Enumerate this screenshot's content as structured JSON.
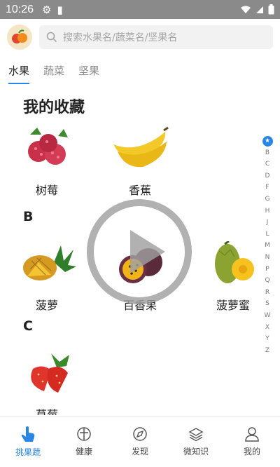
{
  "status": {
    "time": "10:26"
  },
  "search": {
    "placeholder": "搜索水果名/蔬菜名/坚果名"
  },
  "tabs": [
    {
      "label": "水果",
      "active": true
    },
    {
      "label": "蔬菜",
      "active": false
    },
    {
      "label": "坚果",
      "active": false
    }
  ],
  "sections": {
    "favorites": "我的收藏",
    "b": "B",
    "c": "C"
  },
  "fruits": {
    "raspberry": "树莓",
    "banana": "香蕉",
    "pineapple": "菠萝",
    "passion_fruit": "百香果",
    "jackfruit": "菠萝蜜",
    "strawberry": "草莓"
  },
  "index_letters": [
    "B",
    "C",
    "D",
    "F",
    "G",
    "H",
    "J",
    "L",
    "M",
    "N",
    "P",
    "Q",
    "R",
    "S",
    "W",
    "X",
    "Y",
    "Z"
  ],
  "index_star": "★",
  "bottom_nav": [
    {
      "label": "挑果蔬",
      "icon": "hand-pointer-icon",
      "active": true
    },
    {
      "label": "健康",
      "icon": "health-icon",
      "active": false
    },
    {
      "label": "发现",
      "icon": "compass-icon",
      "active": false
    },
    {
      "label": "微知识",
      "icon": "layers-icon",
      "active": false
    },
    {
      "label": "我的",
      "icon": "user-icon",
      "active": false
    }
  ],
  "colors": {
    "accent": "#2a86e6",
    "status_bar": "#8a8a8a"
  }
}
